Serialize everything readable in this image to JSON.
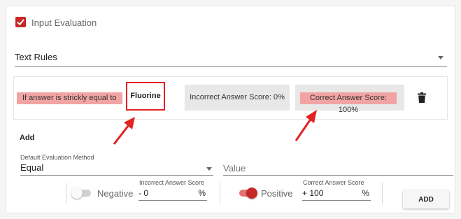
{
  "evaluation": {
    "checkbox_label": "Input Evaluation",
    "checked": true
  },
  "rules_select": {
    "value": "Text Rules"
  },
  "rule": {
    "condition": "If answer is strickly equal to",
    "answer": "Fluorine",
    "incorrect_score": "Incorrect Answer Score: 0%",
    "correct_score": "Correct Answer Score: 100%"
  },
  "add_link": "Add",
  "default_method": {
    "label": "Default Evaluation Method",
    "value": "Equal"
  },
  "value_field": {
    "placeholder": "Value"
  },
  "negative": {
    "toggle_label": "Negative",
    "field_label": "Incorrect Answer Score",
    "sign": "- 0",
    "unit": "%",
    "on": false
  },
  "positive": {
    "toggle_label": "Positive",
    "field_label": "Correct Answer Score",
    "sign": "+ 100",
    "unit": "%",
    "on": true
  },
  "add_button": "ADD",
  "colors": {
    "accent": "#c62828",
    "highlight": "#f2a4a4",
    "annotation": "#e32222"
  },
  "icons": {
    "checkbox": "check-icon",
    "dropdown": "caret-down-icon",
    "delete": "trash-icon",
    "annotation": "red-arrow-icon"
  }
}
